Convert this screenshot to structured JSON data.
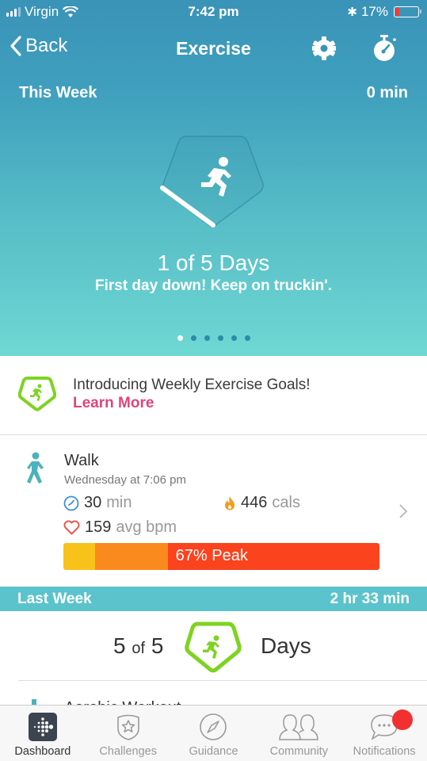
{
  "status_bar": {
    "carrier": "Virgin",
    "time": "7:42 pm",
    "battery_percent": "17%",
    "battery_level": 0.17,
    "battery_color": "#ff3b30"
  },
  "nav": {
    "back_label": "Back",
    "title": "Exercise",
    "icons": [
      "gear-icon",
      "stopwatch-icon"
    ]
  },
  "this_week": {
    "label": "This Week",
    "total": "0 min",
    "progress_days": 1,
    "goal_days": 5,
    "days_text": "1 of 5 Days",
    "message": "First day down! Keep on truckin'.",
    "page_count": 6,
    "active_page": 0
  },
  "promo": {
    "title": "Introducing Weekly Exercise Goals!",
    "link": "Learn More",
    "link_color": "#e0457b",
    "badge_color": "#7ed321"
  },
  "activity": {
    "name": "Walk",
    "time": "Wednesday at 7:06 pm",
    "duration_value": "30",
    "duration_unit": "min",
    "calories_value": "446",
    "calories_unit": "cals",
    "bpm_value": "159",
    "bpm_unit": "avg bpm",
    "zones": [
      {
        "name": "fat-burn",
        "fraction": 0.1,
        "color": "#f9c21a"
      },
      {
        "name": "cardio",
        "fraction": 0.23,
        "color": "#fb8a1e"
      },
      {
        "name": "peak",
        "fraction": 0.67,
        "color": "#fb431e"
      }
    ],
    "zone_label": "67% Peak"
  },
  "last_week": {
    "label": "Last Week",
    "total": "2 hr 33 min",
    "achieved": "5",
    "of_label": "of",
    "goal": "5",
    "days_label": "Days"
  },
  "peek_item": {
    "label": "Aerobic Workout"
  },
  "tabbar": {
    "items": [
      {
        "label": "Dashboard",
        "icon": "fitbit-dashboard-icon",
        "active": true
      },
      {
        "label": "Challenges",
        "icon": "challenges-star-badge-icon",
        "active": false
      },
      {
        "label": "Guidance",
        "icon": "compass-icon",
        "active": false
      },
      {
        "label": "Community",
        "icon": "people-icon",
        "active": false
      },
      {
        "label": "Notifications",
        "icon": "chat-bubble-icon",
        "active": false,
        "badge": true
      }
    ]
  },
  "colors": {
    "hero_top": "#3a93b8",
    "hero_bottom": "#6ed8d3",
    "last_week_bar": "#5bc3cb",
    "activity_icon": "#4bb3bc"
  }
}
